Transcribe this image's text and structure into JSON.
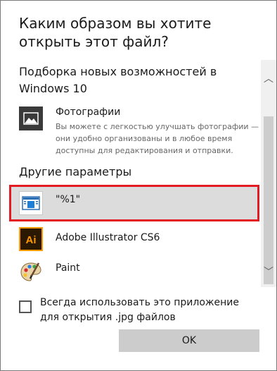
{
  "dialog": {
    "title": "Каким образом вы хотите открыть этот файл?"
  },
  "featured": {
    "header": "Подборка новых возможностей в Windows 10",
    "app": {
      "name": "Фотографии",
      "description": "Вы можете с легкостью улучшать фотографии — они удобно организованы и в любое время доступны для редактирования и отправки.",
      "icon": "photos-icon"
    }
  },
  "other": {
    "header": "Другие параметры",
    "items": [
      {
        "name": "\"%1\"",
        "icon": "generic-app-icon",
        "selected": true
      },
      {
        "name": "Adobe Illustrator CS6",
        "icon": "illustrator-icon",
        "icon_text": "Ai"
      },
      {
        "name": "Paint",
        "icon": "paint-palette-icon"
      }
    ]
  },
  "scroll": {
    "up_glyph": "︿",
    "down_glyph": "﹀"
  },
  "always_use": {
    "label": "Всегда использовать это приложение для открытия .jpg файлов",
    "checked": false
  },
  "ok_button": {
    "label": "OK"
  },
  "colors": {
    "selection_highlight": "#dcdcdc",
    "annotation_red": "#e31b23",
    "button_bg": "#cccccc",
    "illustrator_orange": "#ff9a00",
    "photos_tile": "#3a3a3a"
  }
}
